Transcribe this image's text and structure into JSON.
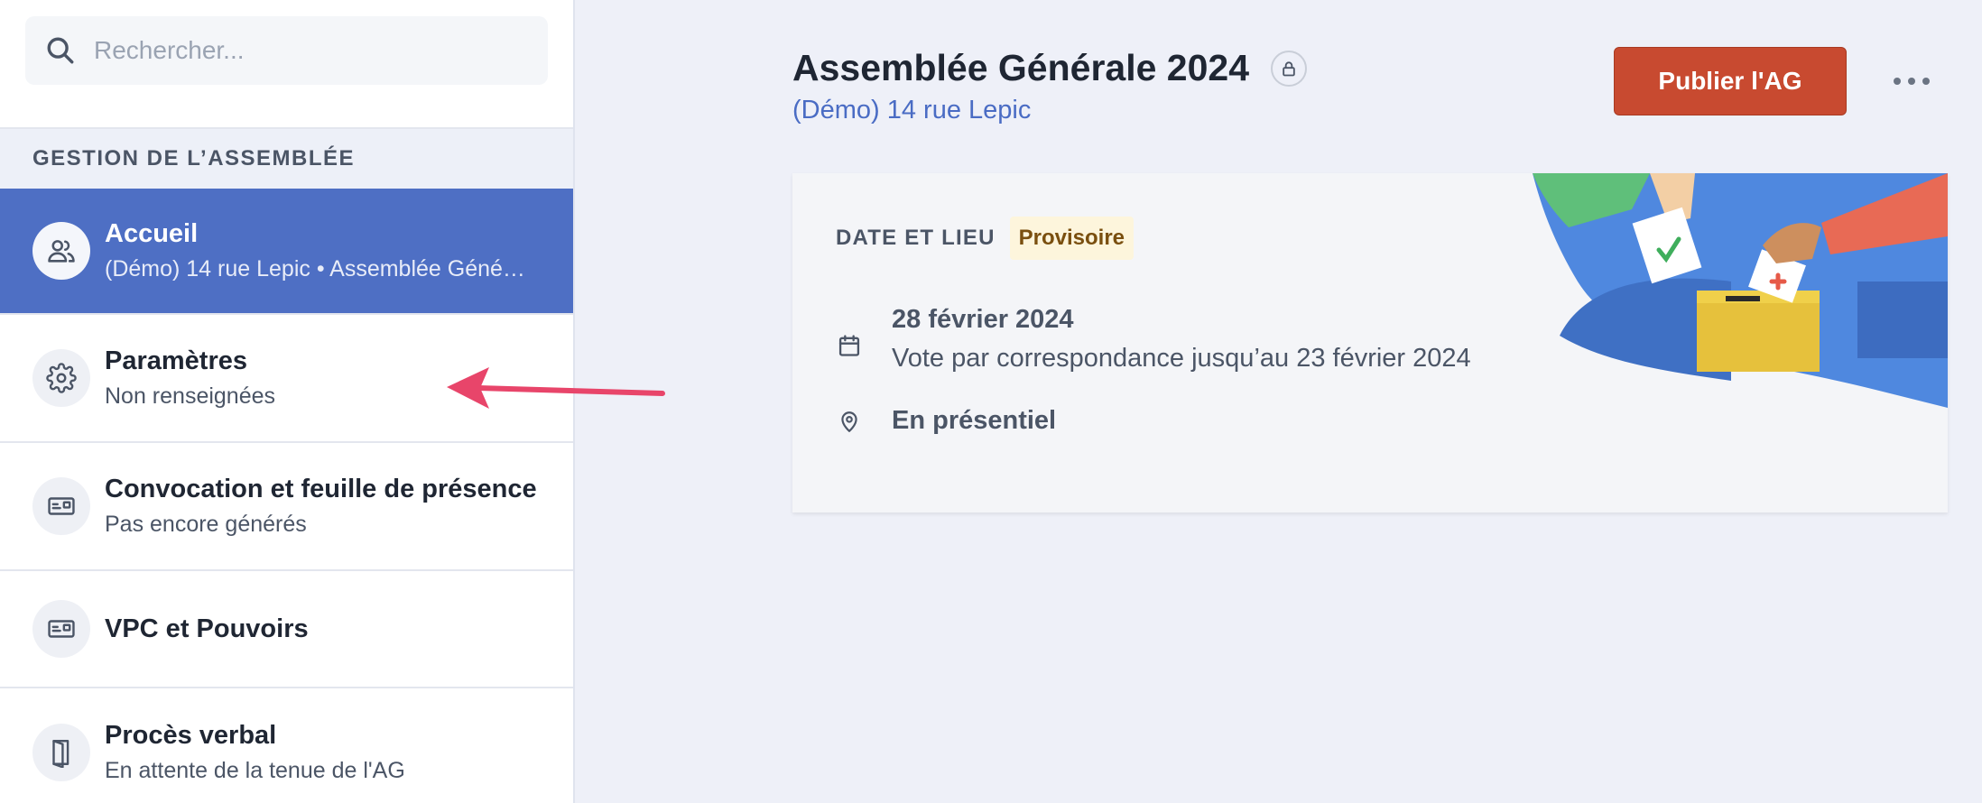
{
  "search": {
    "placeholder": "Rechercher..."
  },
  "sidebar": {
    "section_label": "GESTION DE L’ASSEMBLÉE",
    "items": [
      {
        "icon": "users-icon",
        "title": "Accueil",
        "subtitle": "(Démo) 14 rue Lepic • Assemblée Générale 2024",
        "active": true
      },
      {
        "icon": "gear-icon",
        "title": "Paramètres",
        "subtitle": "Non renseignées"
      },
      {
        "icon": "id-card-icon",
        "title": "Convocation et feuille de présence",
        "subtitle": "Pas encore générés"
      },
      {
        "icon": "id-card-icon",
        "title": "VPC et Pouvoirs",
        "subtitle": ""
      },
      {
        "icon": "door-icon",
        "title": "Procès verbal",
        "subtitle": "En attente de la tenue de l'AG"
      }
    ]
  },
  "main": {
    "title": "Assemblée Générale 2024",
    "subtitle": "(Démo) 14 rue Lepic",
    "publish_label": "Publier l'AG",
    "card": {
      "header": "DATE ET LIEU",
      "badge": "Provisoire",
      "date": "28 février 2024",
      "vote_note": "Vote par correspondance jusqu’au 23 février 2024",
      "location": "En présentiel"
    }
  },
  "colors": {
    "accent": "#4e6fc4",
    "publish": "#c84a30",
    "link": "#4a6cc4",
    "badge_bg": "#fdf5dc",
    "arrow": "#e8456a"
  }
}
